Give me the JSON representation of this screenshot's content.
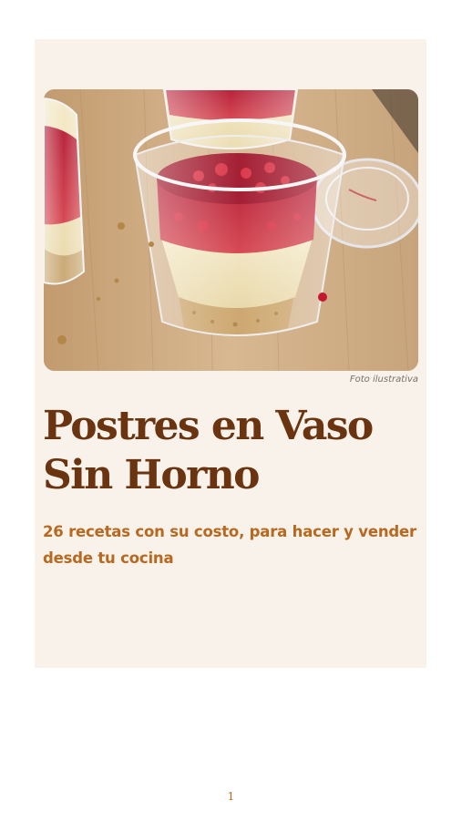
{
  "cover": {
    "photo_caption": "Foto ilustrativa",
    "title": "Postres en Vaso Sin Horno",
    "subtitle": "26 recetas con su costo, para hacer y vender desde tu cocina"
  },
  "footer": {
    "page_number": "1"
  },
  "colors": {
    "card_background": "#f8f2ea",
    "title": "#6b3410",
    "subtitle": "#b8681f",
    "page_number": "#b8681f"
  }
}
